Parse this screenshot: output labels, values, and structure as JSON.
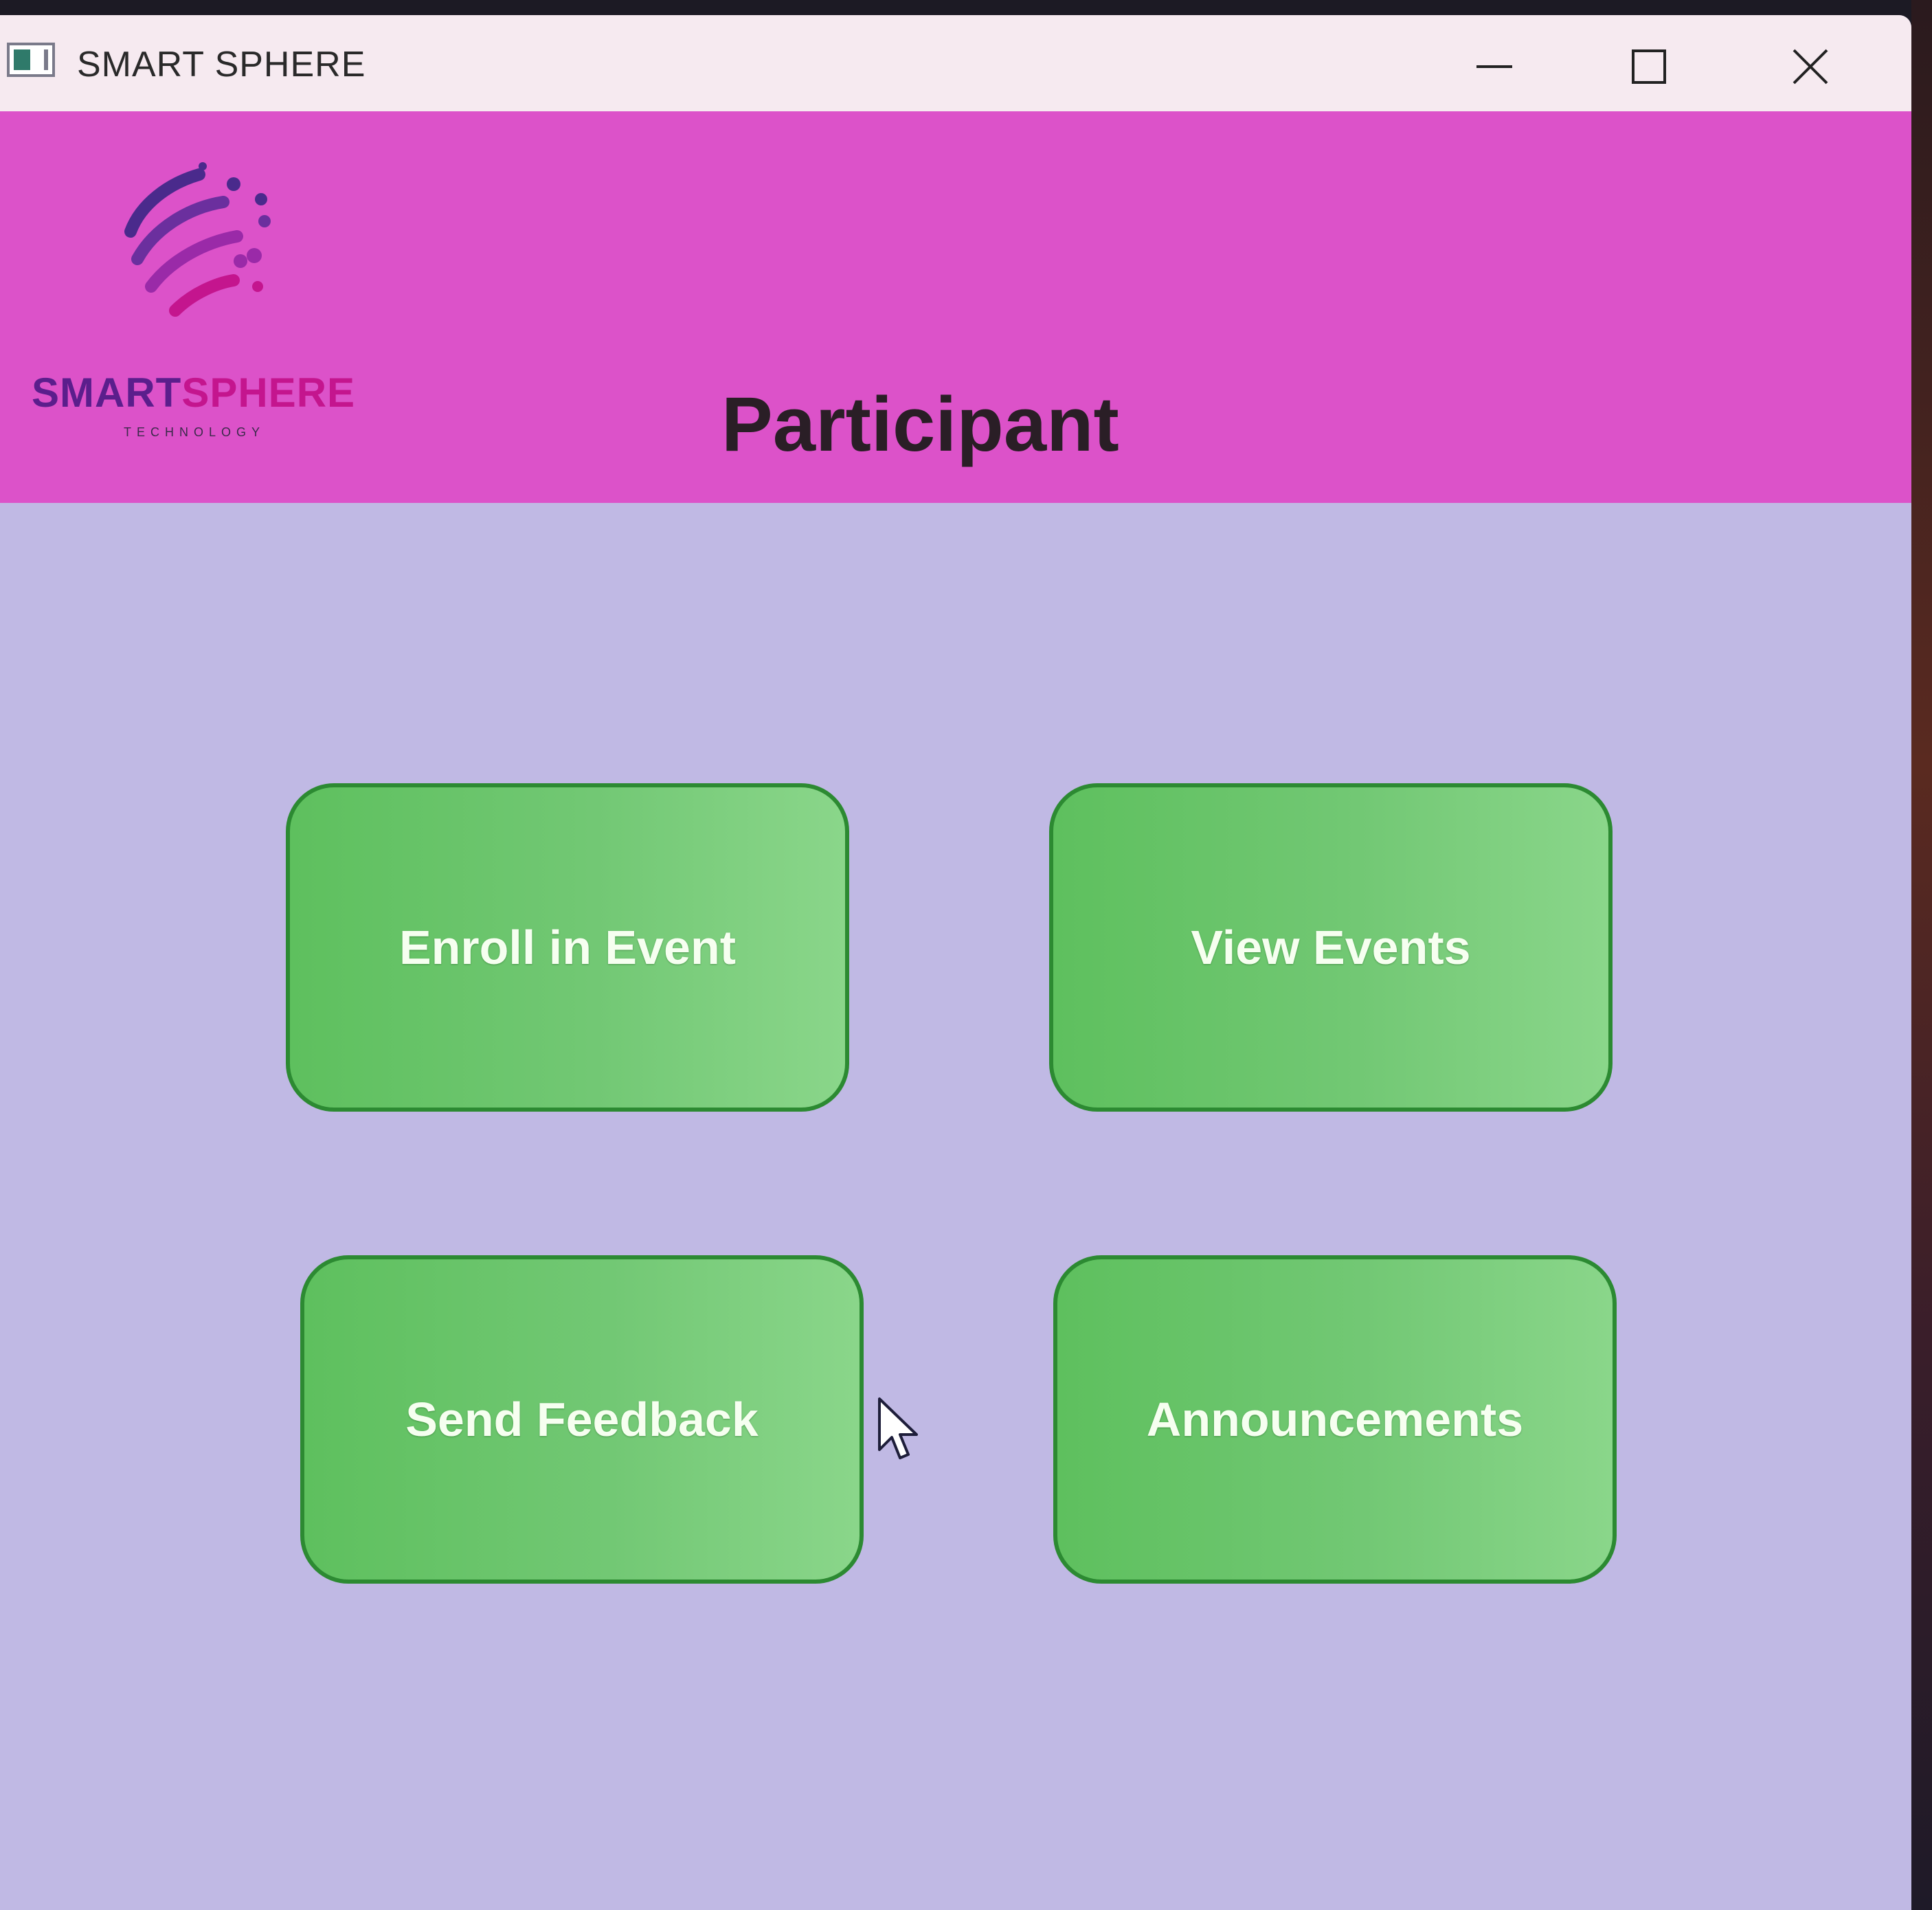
{
  "window": {
    "title": "SMART SPHERE"
  },
  "logo": {
    "word_part1": "SMART",
    "word_part2": "SPHERE",
    "tagline": "TECHNOLOGY"
  },
  "header": {
    "title": "Participant",
    "background": "#dc52c9"
  },
  "actions": [
    {
      "label": "Enroll in Event"
    },
    {
      "label": "View Events"
    },
    {
      "label": "Send Feedback"
    },
    {
      "label": "Announcements"
    }
  ],
  "colors": {
    "content_background": "#c0b9e4",
    "button_fill": "#72c874",
    "button_border": "#2c8a32",
    "button_text": "#f6fff0"
  },
  "icons": {
    "app": "app-icon",
    "minimize": "minimize-icon",
    "maximize": "maximize-icon",
    "close": "close-icon",
    "cursor": "mouse-cursor-icon"
  }
}
